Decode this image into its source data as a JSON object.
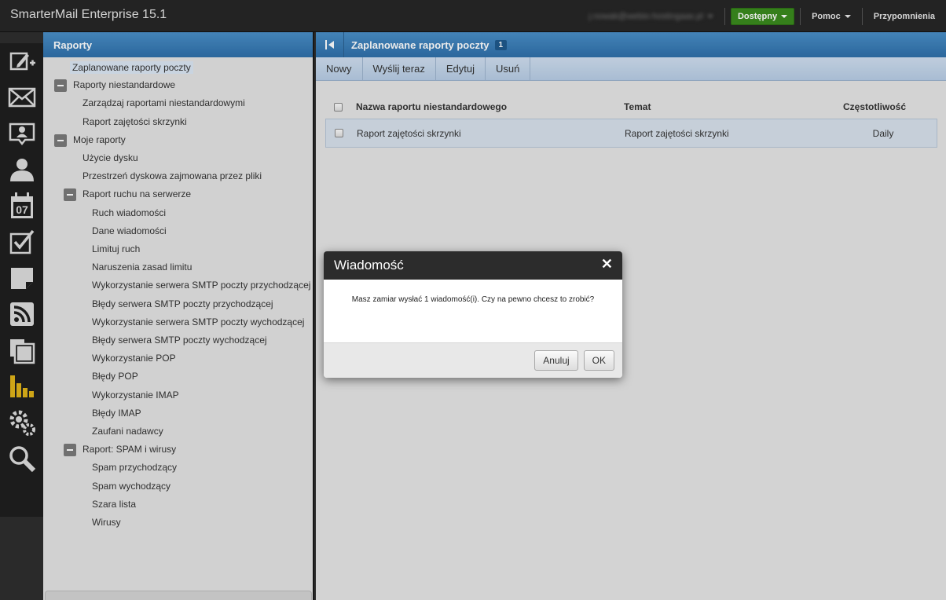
{
  "app": {
    "title": "SmarterMail Enterprise 15.1",
    "user_email": "j.nowak@webio-hostingaas.pl",
    "status_label": "Dostępny",
    "help_label": "Pomoc",
    "reminders_label": "Przypomnienia"
  },
  "rail": {
    "icons": [
      "compose-icon",
      "mail-icon",
      "contacts-icon",
      "user-icon",
      "calendar-icon",
      "tasks-icon",
      "notes-icon",
      "rss-icon",
      "files-icon",
      "reports-icon",
      "settings-icon",
      "search-icon"
    ],
    "calendar_day": "07",
    "active_color": "#e0b41a"
  },
  "left_panel": {
    "title": "Raporty",
    "items": [
      {
        "label": "Zaplanowane raporty poczty",
        "level": 0,
        "selected": true
      },
      {
        "label": "Raporty niestandardowe",
        "level": 0,
        "toggle": true
      },
      {
        "label": "Zarządzaj raportami niestandardowymi",
        "level": 1
      },
      {
        "label": "Raport zajętości skrzynki",
        "level": 1
      },
      {
        "label": "Moje raporty",
        "level": 0,
        "toggle": true
      },
      {
        "label": "Użycie dysku",
        "level": 1
      },
      {
        "label": "Przestrzeń dyskowa zajmowana przez pliki",
        "level": 1
      },
      {
        "label": "Raport ruchu na serwerze",
        "level": 1,
        "toggle": true
      },
      {
        "label": "Ruch wiadomości",
        "level": 2
      },
      {
        "label": "Dane wiadomości",
        "level": 2
      },
      {
        "label": "Limituj ruch",
        "level": 2
      },
      {
        "label": "Naruszenia zasad limitu",
        "level": 2
      },
      {
        "label": "Wykorzystanie serwera SMTP poczty przychodzącej",
        "level": 2
      },
      {
        "label": "Błędy serwera SMTP poczty przychodzącej",
        "level": 2
      },
      {
        "label": "Wykorzystanie serwera SMTP poczty wychodzącej",
        "level": 2
      },
      {
        "label": "Błędy serwera SMTP poczty wychodzącej",
        "level": 2
      },
      {
        "label": "Wykorzystanie POP",
        "level": 2
      },
      {
        "label": "Błędy POP",
        "level": 2
      },
      {
        "label": "Wykorzystanie IMAP",
        "level": 2
      },
      {
        "label": "Błędy IMAP",
        "level": 2
      },
      {
        "label": "Zaufani nadawcy",
        "level": 2
      },
      {
        "label": "Raport: SPAM i wirusy",
        "level": 1,
        "toggle": true
      },
      {
        "label": "Spam przychodzący",
        "level": 2
      },
      {
        "label": "Spam wychodzący",
        "level": 2
      },
      {
        "label": "Szara lista",
        "level": 2
      },
      {
        "label": "Wirusy",
        "level": 2
      }
    ]
  },
  "main": {
    "title": "Zaplanowane raporty poczty",
    "count": "1",
    "toolbar": {
      "new": "Nowy",
      "send_now": "Wyślij teraz",
      "edit": "Edytuj",
      "delete": "Usuń"
    },
    "columns": {
      "name": "Nazwa raportu niestandardowego",
      "subject": "Temat",
      "frequency": "Częstotliwość"
    },
    "rows": [
      {
        "name": "Raport zajętości skrzynki",
        "subject": "Raport zajętości skrzynki",
        "frequency": "Daily"
      }
    ]
  },
  "dialog": {
    "title": "Wiadomość",
    "close": "✕",
    "message": "Masz zamiar wysłać 1 wiadomość(i). Czy na pewno chcesz to zrobić?",
    "cancel_label": "Anuluj",
    "ok_label": "OK"
  },
  "colors": {
    "header_blue": "#3a7fbd",
    "status_green": "#3a8a1e",
    "selected_row": "#d7e1ec"
  }
}
